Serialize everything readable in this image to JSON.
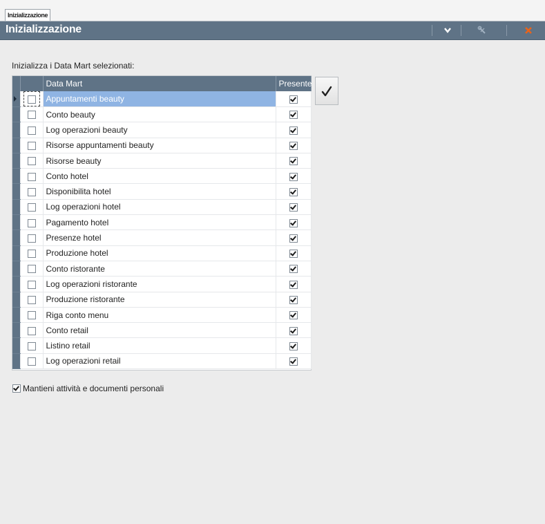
{
  "tab": {
    "label": "Inizializzazione"
  },
  "header": {
    "title": "Inizializzazione",
    "icons": [
      "chevron-down-icon",
      "wrench-icon",
      "close-icon"
    ],
    "close_color": "#e8641b"
  },
  "instructions": "Inizializza i Data Mart selezionati:",
  "table": {
    "columns": {
      "name": "Data Mart",
      "present": "Presente"
    },
    "selected_index": 0,
    "rows": [
      {
        "name": "Appuntamenti beauty",
        "selected": false,
        "present": true
      },
      {
        "name": "Conto beauty",
        "selected": false,
        "present": true
      },
      {
        "name": "Log operazioni beauty",
        "selected": false,
        "present": true
      },
      {
        "name": "Risorse appuntamenti beauty",
        "selected": false,
        "present": true
      },
      {
        "name": "Risorse beauty",
        "selected": false,
        "present": true
      },
      {
        "name": "Conto hotel",
        "selected": false,
        "present": true
      },
      {
        "name": "Disponibilita hotel",
        "selected": false,
        "present": true
      },
      {
        "name": "Log operazioni hotel",
        "selected": false,
        "present": true
      },
      {
        "name": "Pagamento hotel",
        "selected": false,
        "present": true
      },
      {
        "name": "Presenze hotel",
        "selected": false,
        "present": true
      },
      {
        "name": "Produzione hotel",
        "selected": false,
        "present": true
      },
      {
        "name": "Conto ristorante",
        "selected": false,
        "present": true
      },
      {
        "name": "Log operazioni ristorante",
        "selected": false,
        "present": true
      },
      {
        "name": "Produzione ristorante",
        "selected": false,
        "present": true
      },
      {
        "name": "Riga conto menu",
        "selected": false,
        "present": true
      },
      {
        "name": "Conto retail",
        "selected": false,
        "present": true
      },
      {
        "name": "Listino retail",
        "selected": false,
        "present": true
      },
      {
        "name": "Log operazioni retail",
        "selected": false,
        "present": true
      }
    ]
  },
  "confirm": {
    "icon": "checkmark-icon"
  },
  "keep_personal": {
    "label": "Mantieni attività e documenti personali",
    "checked": true
  },
  "colors": {
    "header": "#5f7386",
    "selection": "#8fb4e3",
    "background": "#ececec"
  }
}
